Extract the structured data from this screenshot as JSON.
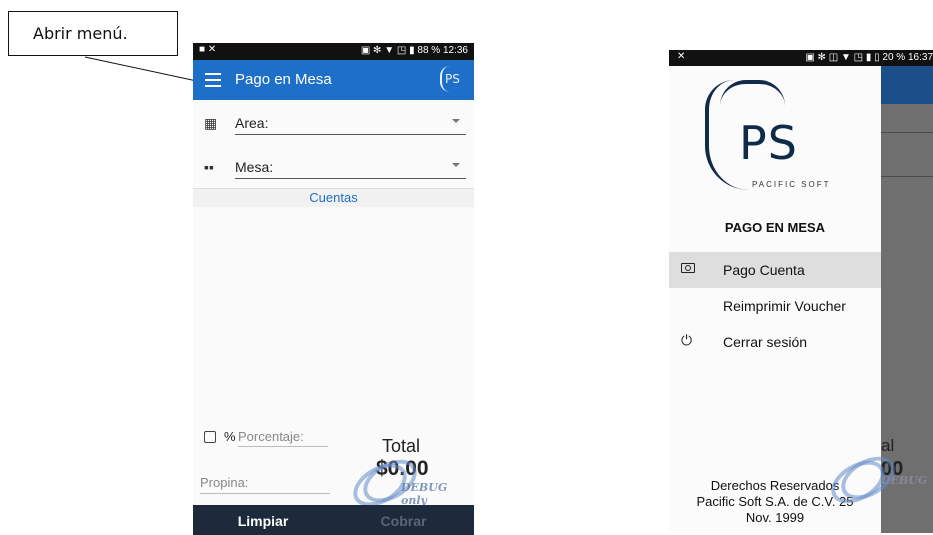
{
  "annotation": {
    "text": "Abrir menú."
  },
  "phone1": {
    "status_left": "■ ✕",
    "status_right": "▣ ✻ ▼ ◳ ▮ 88 %  12:36",
    "toolbar_title": "Pago en Mesa",
    "logo_text": "PS",
    "area_label": "Area:",
    "mesa_label": "Mesa:",
    "cuentas_header": "Cuentas",
    "percent_symbol": "%",
    "porcentaje_placeholder": "Porcentaje:",
    "total_label": "Total",
    "total_value": "$0.00",
    "propina_placeholder": "Propina:",
    "debug_text": "DEBUG only",
    "limpiar_button": "Limpiar",
    "cobrar_button": "Cobrar"
  },
  "phone2": {
    "status_left": "✕",
    "status_right": "▣ ✻ ◫ ▼ ◳ ▮ ▯ 20 %  16:37",
    "logo_text": "PS",
    "logo_subtitle": "PACIFIC SOFT",
    "app_name": "PAGO EN MESA",
    "menu": [
      {
        "label": "Pago Cuenta",
        "icon": "cash-icon",
        "selected": true
      },
      {
        "label": "Reimprimir Voucher",
        "icon": "",
        "selected": false
      },
      {
        "label": "Cerrar sesión",
        "icon": "power-icon",
        "selected": false
      }
    ],
    "footer_line1": "Derechos Reservados",
    "footer_line2": "Pacific Soft S.A. de C.V. 25",
    "footer_line3": "Nov. 1999",
    "behind_total_fragment": "al",
    "behind_value_fragment": "00",
    "debug_text": "DEBUG"
  }
}
